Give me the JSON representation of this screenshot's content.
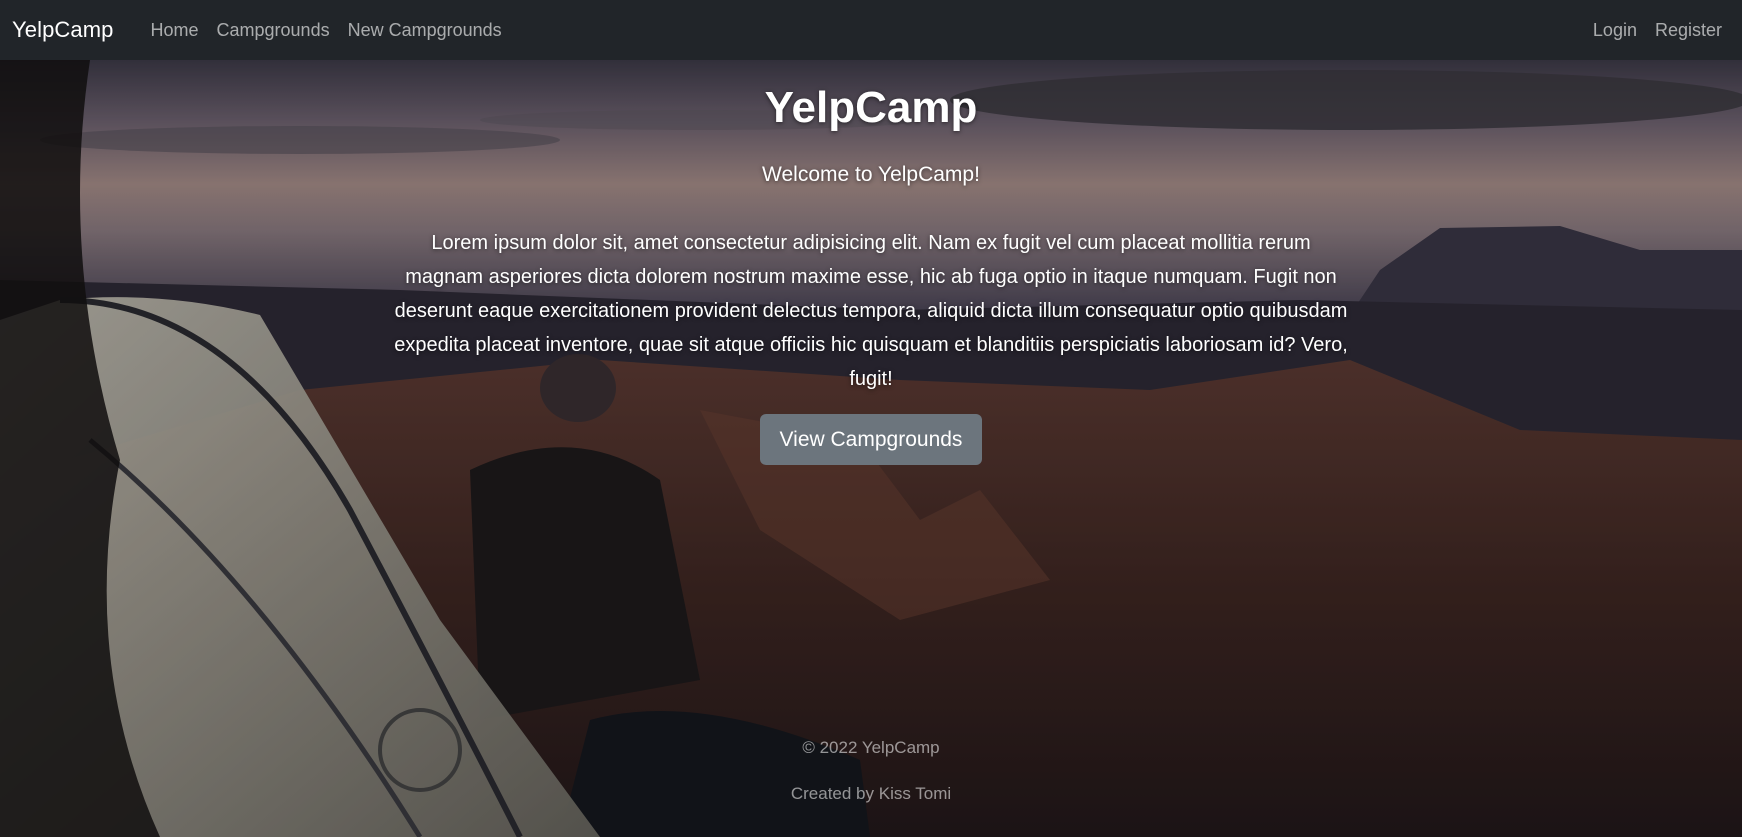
{
  "navbar": {
    "brand": "YelpCamp",
    "links": [
      {
        "label": "Home"
      },
      {
        "label": "Campgrounds"
      },
      {
        "label": "New Campgrounds"
      }
    ],
    "auth": [
      {
        "label": "Login"
      },
      {
        "label": "Register"
      }
    ]
  },
  "hero": {
    "title": "YelpCamp",
    "welcome": "Welcome to YelpCamp!",
    "lead": "Lorem ipsum dolor sit, amet consectetur adipisicing elit. Nam ex fugit vel cum placeat mollitia rerum magnam asperiores dicta dolorem nostrum maxime esse, hic ab fuga optio in itaque numquam. Fugit non deserunt eaque exercitationem provident delectus tempora, aliquid dicta illum consequatur optio quibusdam expedita placeat inventore, quae sit atque officiis hic quisquam et blanditiis perspiciatis laboriosam id? Vero, fugit!",
    "button_label": "View Campgrounds"
  },
  "footer": {
    "copyright": "© 2022 YelpCamp",
    "credit": "Created by Kiss Tomi"
  },
  "colors": {
    "navbar_bg": "#212529",
    "button_bg": "#6c757d"
  }
}
